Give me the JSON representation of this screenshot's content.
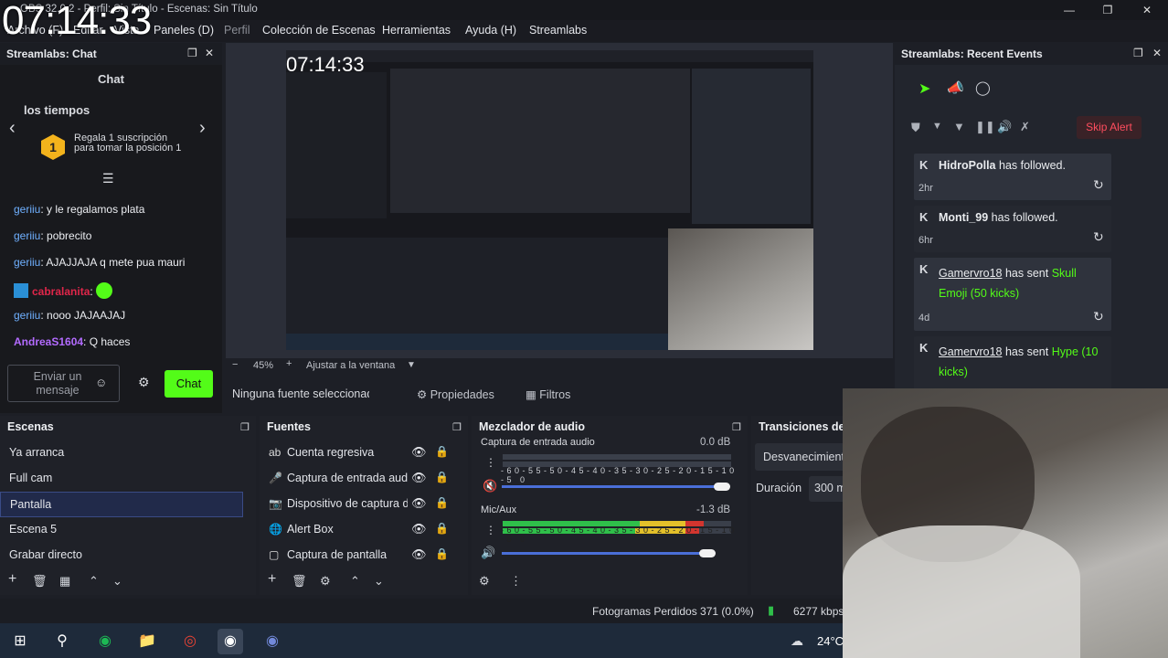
{
  "window": {
    "title": "OBS 32.0.2 - Perfil: Sin Título - Escenas: Sin Título",
    "clock": "07:14:33"
  },
  "menu": [
    "Archivo (F)",
    "Editar",
    "Vista",
    "Paneles (D)",
    "Perfil",
    "Colección de Escenas",
    "Herramientas",
    "Ayuda (H)",
    "Streamlabs"
  ],
  "chat": {
    "dock_title": "Streamlabs: Chat",
    "header": "Chat",
    "promo_title": "los tiempos",
    "promo_text": "Regala 1 suscripción para tomar la posición 1",
    "promo_rank": "1",
    "messages": [
      {
        "user": "geriiu",
        "text": "y le regalamos plata"
      },
      {
        "user": "geriiu",
        "text": "pobrecito"
      },
      {
        "user": "geriiu",
        "text": "AJAJJAJA q mete pua mauri"
      },
      {
        "user": "cabralanita",
        "text": ":"
      },
      {
        "user": "geriiu",
        "text": "nooo JAJAAJAJ"
      },
      {
        "user": "AndreaS1604",
        "text": "Q haces"
      }
    ],
    "input_placeholder": "Enviar un mensaje",
    "send_label": "Chat",
    "colors": {
      "user": "#6fb0ff",
      "cabralanita": "#e0264a",
      "andrea": "#b36bff",
      "send": "#53fc18"
    }
  },
  "preview": {
    "zoom": "45%",
    "fit": "Ajustar a la ventana"
  },
  "source_bar": {
    "none_selected": "Ninguna fuente seleccionada",
    "properties": "Propiedades",
    "filters": "Filtros"
  },
  "events": {
    "dock_title": "Streamlabs: Recent Events",
    "skip_alert": "Skip Alert",
    "items": [
      {
        "user": "HidroPolla",
        "action": "has followed.",
        "extra": "",
        "time": "2hr"
      },
      {
        "user": "Monti_99",
        "action": "has followed.",
        "extra": "",
        "time": "6hr"
      },
      {
        "user": "Gamervro18",
        "action": "has sent",
        "extra": "Skull Emoji (50 kicks)",
        "time": "4d"
      },
      {
        "user": "Gamervro18",
        "action": "has sent",
        "extra": "Hype (10 kicks)",
        "time": ""
      }
    ]
  },
  "scenes": {
    "title": "Escenas",
    "items": [
      "Ya arranca",
      "Full cam",
      "Pantalla",
      "Escena 5",
      "Grabar directo"
    ],
    "selected": 2
  },
  "sources": {
    "title": "Fuentes",
    "items": [
      "Cuenta regresiva",
      "Captura de entrada audio",
      "Dispositivo de captura de video",
      "Alert Box",
      "Captura de pantalla"
    ]
  },
  "mixer": {
    "title": "Mezclador de audio",
    "channels": [
      {
        "name": "Captura de entrada audio",
        "db": "0.0 dB",
        "level": 0.0,
        "volume": 1.0,
        "muted": true
      },
      {
        "name": "Mic/Aux",
        "db": "-1.3 dB",
        "level": 0.88,
        "volume": 0.92,
        "muted": false
      }
    ],
    "scale": [
      "-60",
      "-55",
      "-50",
      "-45",
      "-40",
      "-35",
      "-30",
      "-25",
      "-20",
      "-15",
      "-10",
      "-5",
      "0"
    ]
  },
  "transitions": {
    "title": "Transiciones de escena",
    "type": "Desvanecimiento",
    "duration_label": "Duración",
    "duration": "300 ms"
  },
  "status": {
    "dropped": "Fotogramas Perdidos 371 (0.0%)",
    "bitrate": "6277 kbps"
  },
  "taskbar": {
    "weather": "24°C"
  }
}
